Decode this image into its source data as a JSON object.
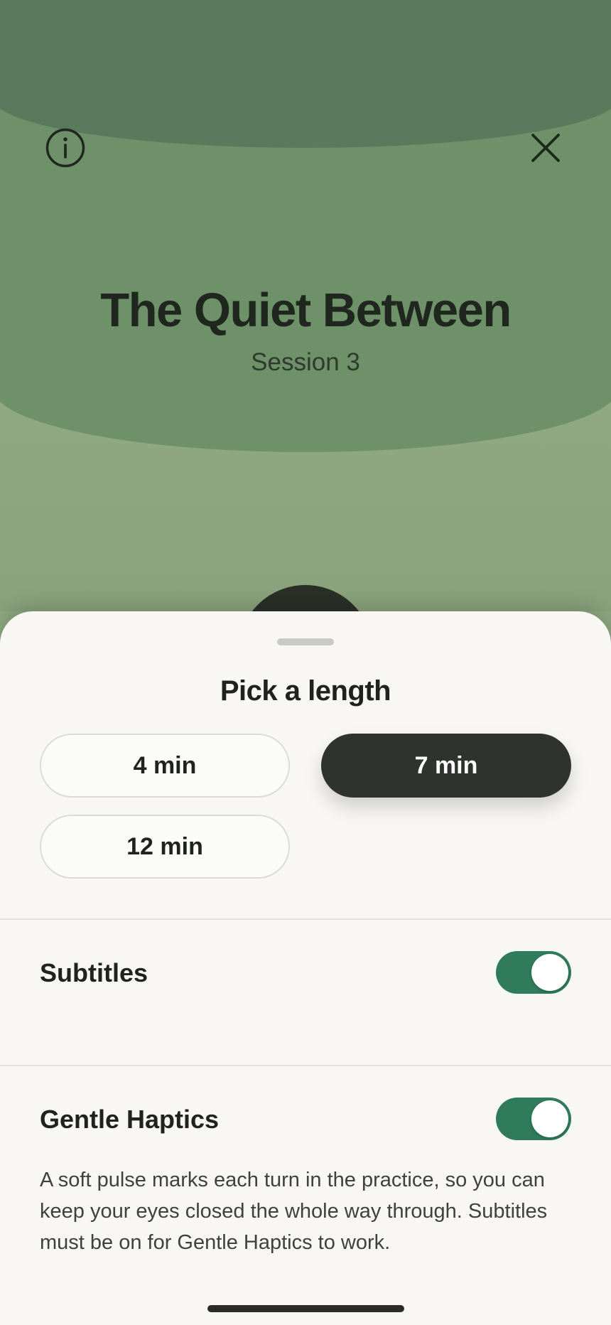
{
  "hero": {
    "title": "The Quiet Between",
    "subtitle": "Session 3",
    "info_icon": "info-circle-icon",
    "close_icon": "close-x-icon"
  },
  "sheet": {
    "title": "Pick a length",
    "lengths": [
      {
        "label": "4 min",
        "selected": false
      },
      {
        "label": "7 min",
        "selected": true
      },
      {
        "label": "12 min",
        "selected": false
      }
    ],
    "settings": [
      {
        "label": "Subtitles",
        "enabled": true
      },
      {
        "label": "Gentle Haptics",
        "enabled": true,
        "description": "A soft pulse marks each turn in the practice, so you can keep your eyes closed the whole way through. Subtitles must be on for Gentle Haptics to work."
      }
    ]
  },
  "colors": {
    "accent": "#2f7b5c",
    "selected_pill": "#2f332e",
    "hero_green": "#6e9169"
  }
}
